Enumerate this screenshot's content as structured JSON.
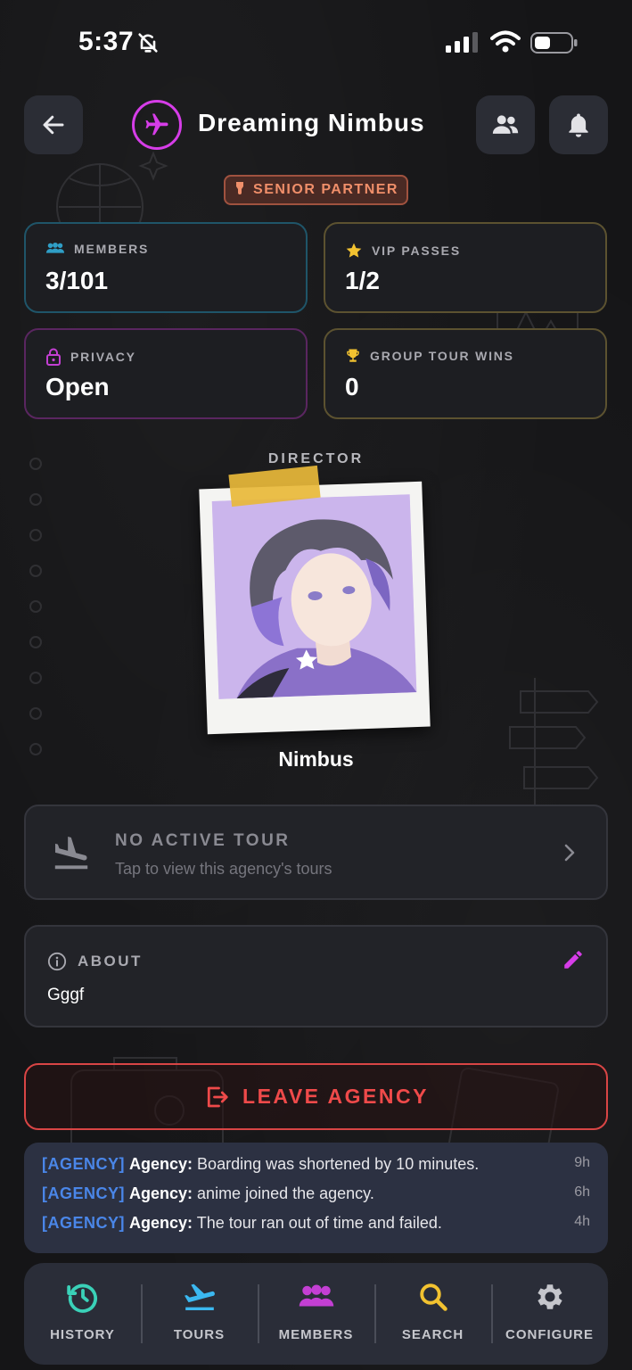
{
  "status_bar": {
    "time": "5:37",
    "icons": [
      "bell-slash-icon",
      "signal-icon",
      "wifi-icon",
      "battery-icon"
    ]
  },
  "header": {
    "back_icon": "arrow-left-icon",
    "logo_icon": "airplane-icon",
    "agency_name": "Dreaming Nimbus",
    "members_icon": "people-icon",
    "bell_icon": "bell-icon",
    "rank": "SENIOR PARTNER"
  },
  "stats": {
    "members": {
      "label": "MEMBERS",
      "value": "3/101",
      "icon": "people-icon",
      "accent": "#2f9ec6"
    },
    "vip": {
      "label": "VIP PASSES",
      "value": "1/2",
      "icon": "star-icon",
      "accent": "#f2c230"
    },
    "privacy": {
      "label": "PRIVACY",
      "value": "Open",
      "icon": "lock-icon",
      "accent": "#c33fd3"
    },
    "wins": {
      "label": "GROUP TOUR WINS",
      "value": "0",
      "icon": "trophy-icon",
      "accent": "#f2c230"
    }
  },
  "director": {
    "label": "DIRECTOR",
    "name": "Nimbus"
  },
  "tour": {
    "title": "NO ACTIVE TOUR",
    "subtitle": "Tap to view this agency's tours",
    "icon": "plane-landing-icon"
  },
  "about": {
    "label": "ABOUT",
    "text": "Gggf",
    "icon": "info-icon",
    "edit_icon": "pencil-icon"
  },
  "leave": {
    "label": "LEAVE AGENCY",
    "icon": "logout-icon",
    "color": "#ef4a4a"
  },
  "feed": [
    {
      "tag": "[AGENCY]",
      "source": "Agency:",
      "message": "Boarding was shortened by 10 minutes.",
      "time": "9h"
    },
    {
      "tag": "[AGENCY]",
      "source": "Agency:",
      "message": "anime joined the agency.",
      "time": "6h"
    },
    {
      "tag": "[AGENCY]",
      "source": "Agency:",
      "message": "The tour ran out of time and failed.",
      "time": "4h"
    }
  ],
  "tabs": [
    {
      "label": "HISTORY",
      "icon": "history-icon",
      "color": "#3ad1b8"
    },
    {
      "label": "TOURS",
      "icon": "plane-takeoff-icon",
      "color": "#3bb8f0"
    },
    {
      "label": "MEMBERS",
      "icon": "people-icon",
      "color": "#c33fd3"
    },
    {
      "label": "SEARCH",
      "icon": "search-icon",
      "color": "#f2c230"
    },
    {
      "label": "CONFIGURE",
      "icon": "gear-icon",
      "color": "#c5c6cc"
    }
  ]
}
